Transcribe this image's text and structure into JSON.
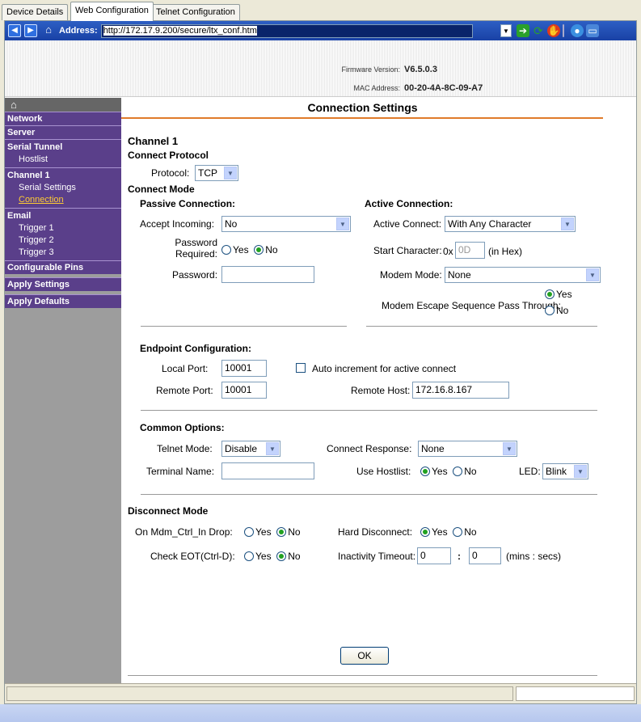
{
  "tabs": [
    "Device Details",
    "Web Configuration",
    "Telnet Configuration"
  ],
  "address": {
    "label": "Address:",
    "url": "http://172.17.9.200/secure/ltx_conf.htm"
  },
  "header": {
    "firmware_label": "Firmware Version:",
    "firmware_value": "V6.5.0.3",
    "mac_label": "MAC Address:",
    "mac_value": "00-20-4A-8C-09-A7"
  },
  "sidebar": {
    "network": "Network",
    "server": "Server",
    "serial_tunnel": "Serial Tunnel",
    "hostlist": "Hostlist",
    "channel1": "Channel 1",
    "serial_settings": "Serial Settings",
    "connection": "Connection",
    "email": "Email",
    "trigger1": "Trigger 1",
    "trigger2": "Trigger 2",
    "trigger3": "Trigger 3",
    "configurable_pins": "Configurable Pins",
    "apply_settings": "Apply Settings",
    "apply_defaults": "Apply Defaults"
  },
  "page_title": "Connection Settings",
  "channel": "Channel 1",
  "connect_protocol": {
    "heading": "Connect Protocol",
    "protocol_label": "Protocol:",
    "protocol_value": "TCP"
  },
  "connect_mode": {
    "heading": "Connect Mode",
    "passive": {
      "heading": "Passive Connection:",
      "accept_label": "Accept Incoming:",
      "accept_value": "No",
      "password_required_label_1": "Password",
      "password_required_label_2": "Required:",
      "yes": "Yes",
      "no": "No",
      "password_label": "Password:",
      "password_value": ""
    },
    "active": {
      "heading": "Active Connection:",
      "active_connect_label": "Active Connect:",
      "active_connect_value": "With Any Character",
      "start_char_label": "Start Character:",
      "start_char_prefix": "0x",
      "start_char_value": "0D",
      "start_char_suffix": "(in Hex)",
      "modem_mode_label": "Modem Mode:",
      "modem_mode_value": "None",
      "escape_label": "Modem Escape Sequence Pass Through:",
      "yes": "Yes",
      "no": "No"
    }
  },
  "endpoint": {
    "heading": "Endpoint Configuration:",
    "local_port_label": "Local Port:",
    "local_port_value": "10001",
    "auto_increment_label": "Auto increment for active connect",
    "remote_port_label": "Remote Port:",
    "remote_port_value": "10001",
    "remote_host_label": "Remote Host:",
    "remote_host_value": "172.16.8.167"
  },
  "common": {
    "heading": "Common Options:",
    "telnet_mode_label": "Telnet Mode:",
    "telnet_mode_value": "Disable",
    "connect_response_label": "Connect Response:",
    "connect_response_value": "None",
    "terminal_name_label": "Terminal Name:",
    "terminal_name_value": "",
    "use_hostlist_label": "Use Hostlist:",
    "yes": "Yes",
    "no": "No",
    "led_label": "LED:",
    "led_value": "Blink"
  },
  "disconnect": {
    "heading": "Disconnect Mode",
    "mdm_label": "On Mdm_Ctrl_In Drop:",
    "eot_label": "Check EOT(Ctrl-D):",
    "hard_label": "Hard Disconnect:",
    "inactivity_label": "Inactivity Timeout:",
    "inactivity_mins": "0",
    "colon": ":",
    "inactivity_secs": "0",
    "inactivity_units": "(mins : secs)",
    "yes": "Yes",
    "no": "No"
  },
  "ok_button": "OK"
}
